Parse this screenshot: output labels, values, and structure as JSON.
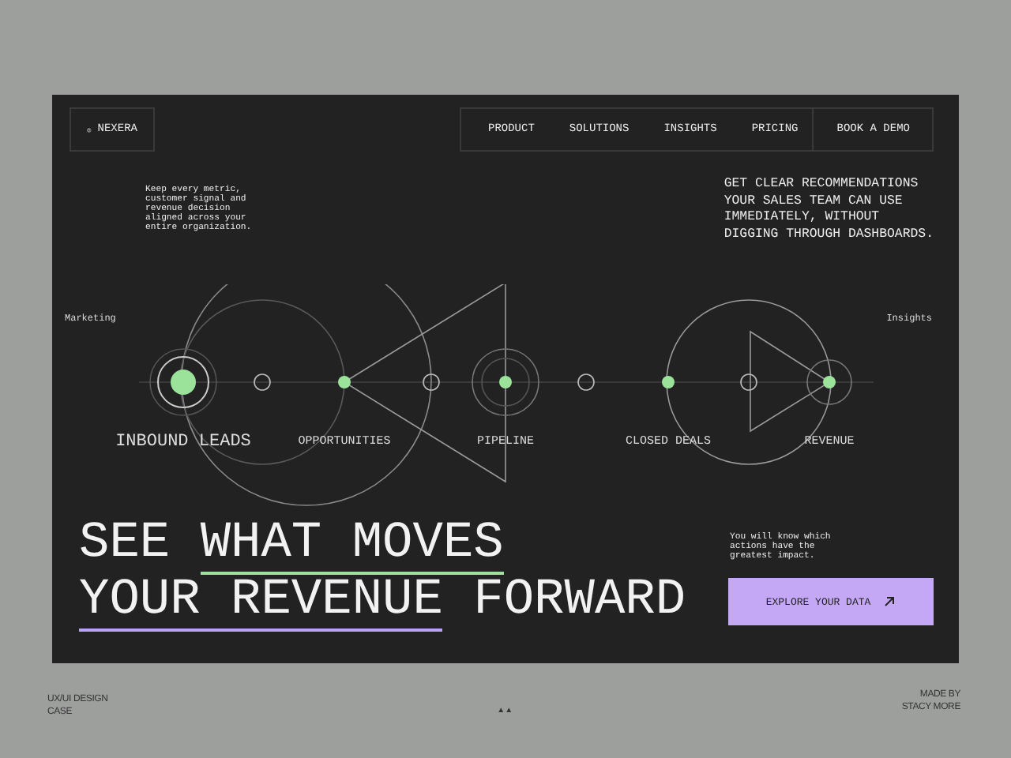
{
  "brand": {
    "name": "NEXERA"
  },
  "nav": [
    {
      "label": "PRODUCT"
    },
    {
      "label": "SOLUTIONS"
    },
    {
      "label": "INSIGHTS"
    },
    {
      "label": "PRICING"
    }
  ],
  "cta_top": "BOOK A DEMO",
  "intro_left": "Keep every metric,\ncustomer signal and\nrevenue decision\naligned across your\nentire organization.",
  "intro_right": "GET CLEAR RECOMMENDATIONS\nYOUR SALES TEAM CAN USE\nIMMEDIATELY, WITHOUT\nDIGGING THROUGH DASHBOARDS.",
  "diagram": {
    "start_label": "Marketing",
    "end_label": "Insights",
    "stages": [
      {
        "label": "INBOUND LEADS",
        "kind": "major"
      },
      {
        "label": "OPPORTUNITIES",
        "kind": "minor"
      },
      {
        "label": "PIPELINE",
        "kind": "ringed"
      },
      {
        "label": "CLOSED DEALS",
        "kind": "minor"
      },
      {
        "label": "REVENUE",
        "kind": "ringed"
      }
    ]
  },
  "headline": [
    [
      {
        "text": "SEE "
      },
      {
        "text": "WHAT MOVES",
        "color": "#9be39a"
      }
    ],
    [
      {
        "text": "YOUR REVENUE",
        "color": "#b9a3f2"
      },
      {
        "text": " FORWARD"
      }
    ]
  ],
  "note": "You will know which\nactions have the\ngreatest impact.",
  "cta": "EXPLORE YOUR DATA",
  "footer": {
    "left": "UX/UI DESIGN\nCASE",
    "center": "▲▲",
    "right": "MADE BY\nSTACY MORE"
  }
}
